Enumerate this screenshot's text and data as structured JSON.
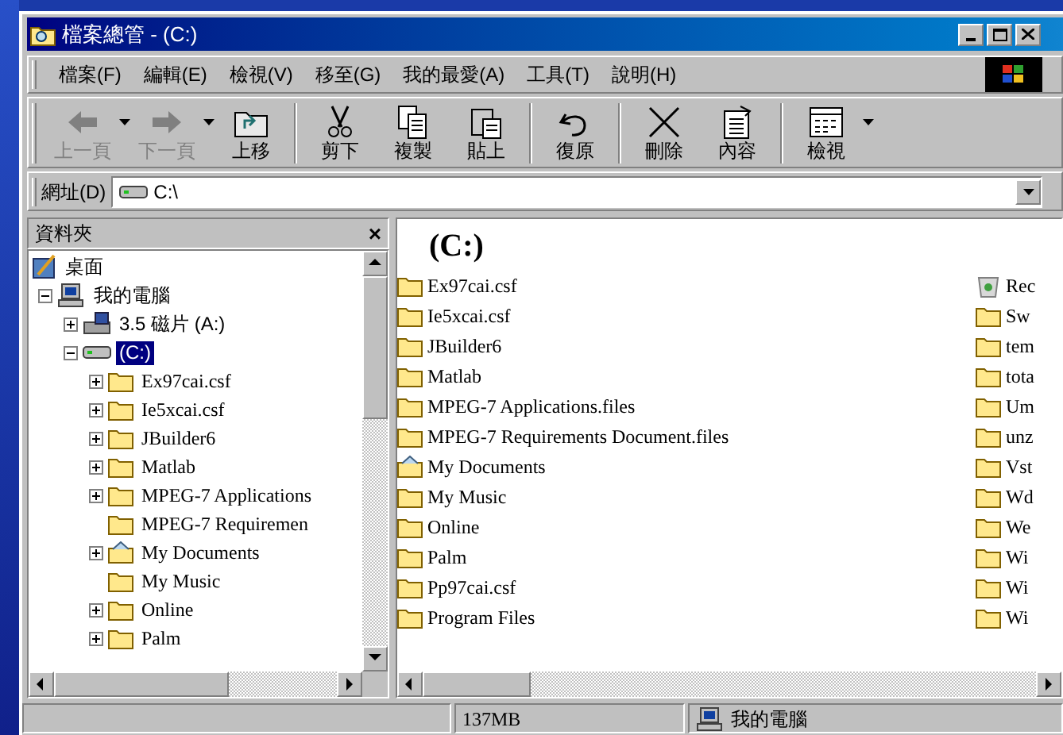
{
  "window": {
    "title": "檔案總管 - (C:)"
  },
  "menu": [
    "檔案(F)",
    "編輯(E)",
    "檢視(V)",
    "移至(G)",
    "我的最愛(A)",
    "工具(T)",
    "說明(H)"
  ],
  "toolbar": [
    {
      "kind": "back",
      "label": "上一頁",
      "disabled": true,
      "dropdown": true
    },
    {
      "kind": "forward",
      "label": "下一頁",
      "disabled": true,
      "dropdown": true
    },
    {
      "kind": "up",
      "label": "上移",
      "disabled": false,
      "dropdown": false
    },
    {
      "kind": "cut",
      "label": "剪下",
      "disabled": false,
      "dropdown": false
    },
    {
      "kind": "copy",
      "label": "複製",
      "disabled": false,
      "dropdown": false
    },
    {
      "kind": "paste",
      "label": "貼上",
      "disabled": false,
      "dropdown": false
    },
    {
      "kind": "undo",
      "label": "復原",
      "disabled": false,
      "dropdown": false
    },
    {
      "kind": "delete",
      "label": "刪除",
      "disabled": false,
      "dropdown": false
    },
    {
      "kind": "properties",
      "label": "內容",
      "disabled": false,
      "dropdown": false
    },
    {
      "kind": "views",
      "label": "檢視",
      "disabled": false,
      "dropdown": true
    }
  ],
  "address": {
    "label": "網址(D)",
    "value": "C:\\"
  },
  "folders_pane": {
    "title": "資料夾",
    "close": "×",
    "tree": [
      {
        "label": "桌面",
        "kind": "desktop",
        "expandable": false,
        "selected": false,
        "children": [
          {
            "label": "我的電腦",
            "kind": "computer",
            "expandable": true,
            "expanded": true,
            "selected": false,
            "children": [
              {
                "label": "3.5 磁片 (A:)",
                "kind": "floppy",
                "expandable": true,
                "expanded": false,
                "selected": false
              },
              {
                "label": "(C:)",
                "kind": "drive",
                "expandable": true,
                "expanded": true,
                "selected": true,
                "children": [
                  {
                    "label": "Ex97cai.csf",
                    "kind": "folder",
                    "expandable": true,
                    "expanded": false,
                    "selected": false
                  },
                  {
                    "label": "Ie5xcai.csf",
                    "kind": "folder",
                    "expandable": true,
                    "expanded": false,
                    "selected": false
                  },
                  {
                    "label": "JBuilder6",
                    "kind": "folder",
                    "expandable": true,
                    "expanded": false,
                    "selected": false
                  },
                  {
                    "label": "Matlab",
                    "kind": "folder",
                    "expandable": true,
                    "expanded": false,
                    "selected": false
                  },
                  {
                    "label": "MPEG-7 Applications",
                    "kind": "folder",
                    "expandable": true,
                    "expanded": false,
                    "selected": false
                  },
                  {
                    "label": "MPEG-7 Requiremen",
                    "kind": "folder",
                    "expandable": false,
                    "selected": false
                  },
                  {
                    "label": "My Documents",
                    "kind": "documents",
                    "expandable": true,
                    "expanded": false,
                    "selected": false
                  },
                  {
                    "label": "My Music",
                    "kind": "folder",
                    "expandable": false,
                    "selected": false
                  },
                  {
                    "label": "Online",
                    "kind": "folder",
                    "expandable": true,
                    "expanded": false,
                    "selected": false
                  },
                  {
                    "label": "Palm",
                    "kind": "folder",
                    "expandable": true,
                    "expanded": false,
                    "selected": false
                  }
                ]
              }
            ]
          }
        ]
      }
    ]
  },
  "contents": {
    "heading": "(C:)",
    "column_1": [
      {
        "name": "Ex97cai.csf",
        "kind": "folder"
      },
      {
        "name": "Ie5xcai.csf",
        "kind": "folder"
      },
      {
        "name": "JBuilder6",
        "kind": "folder"
      },
      {
        "name": "Matlab",
        "kind": "folder"
      },
      {
        "name": "MPEG-7 Applications.files",
        "kind": "folder"
      },
      {
        "name": "MPEG-7 Requirements Document.files",
        "kind": "folder"
      },
      {
        "name": "My Documents",
        "kind": "documents"
      },
      {
        "name": "My Music",
        "kind": "folder"
      },
      {
        "name": "Online",
        "kind": "folder"
      },
      {
        "name": "Palm",
        "kind": "folder"
      },
      {
        "name": "Pp97cai.csf",
        "kind": "folder"
      },
      {
        "name": "Program Files",
        "kind": "folder"
      }
    ],
    "column_2": [
      {
        "name": "Rec",
        "kind": "recycle"
      },
      {
        "name": "Sw",
        "kind": "folder"
      },
      {
        "name": "tem",
        "kind": "folder"
      },
      {
        "name": "tota",
        "kind": "folder"
      },
      {
        "name": "Um",
        "kind": "folder"
      },
      {
        "name": "unz",
        "kind": "folder"
      },
      {
        "name": "Vst",
        "kind": "folder"
      },
      {
        "name": "Wd",
        "kind": "folder"
      },
      {
        "name": "We",
        "kind": "folder"
      },
      {
        "name": "Wi",
        "kind": "folder"
      },
      {
        "name": "Wi",
        "kind": "folder"
      },
      {
        "name": "Wi",
        "kind": "folder"
      }
    ]
  },
  "status_bar": {
    "size": "137MB",
    "location": "我的電腦"
  }
}
